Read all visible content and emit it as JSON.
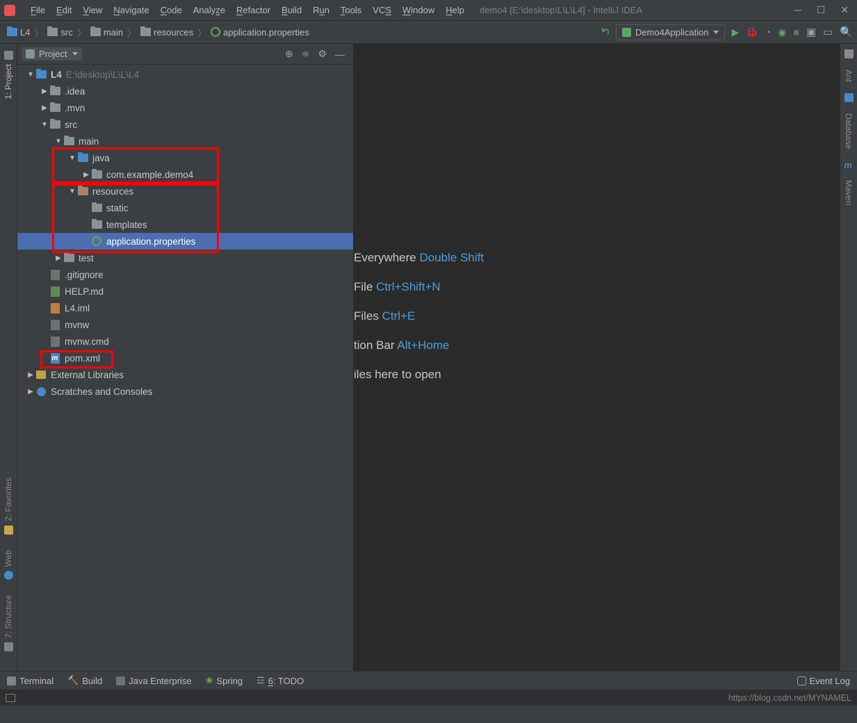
{
  "titlebar": {
    "menus": [
      "File",
      "Edit",
      "View",
      "Navigate",
      "Code",
      "Analyze",
      "Refactor",
      "Build",
      "Run",
      "Tools",
      "VCS",
      "Window",
      "Help"
    ],
    "title": "demo4 [E:\\desktop\\L\\L\\L4] - IntelliJ IDEA"
  },
  "breadcrumb": {
    "items": [
      "L4",
      "src",
      "main",
      "resources",
      "application.properties"
    ]
  },
  "run_config": {
    "label": "Demo4Application"
  },
  "panel": {
    "title": "Project"
  },
  "tree": {
    "root": {
      "name": "L4",
      "path": "E:\\desktop\\L\\L\\L4"
    },
    "idea": ".idea",
    "mvn": ".mvn",
    "src": "src",
    "main": "main",
    "java": "java",
    "pkg": "com.example.demo4",
    "resources": "resources",
    "static": "static",
    "templates": "templates",
    "appprops": "application.properties",
    "test": "test",
    "gitignore": ".gitignore",
    "help": "HELP.md",
    "iml": "L4.iml",
    "mvnw": "mvnw",
    "mvnwcmd": "mvnw.cmd",
    "pom": "pom.xml",
    "ext": "External Libraries",
    "scratch": "Scratches and Consoles"
  },
  "editor_hints": {
    "r1a": "Everywhere  ",
    "r1b": "Double Shift",
    "r2a": "File  ",
    "r2b": "Ctrl+Shift+N",
    "r3a": " Files  ",
    "r3b": "Ctrl+E",
    "r4a": "tion Bar  ",
    "r4b": "Alt+Home",
    "r5": "iles here to open"
  },
  "left_tabs": {
    "project": "1: Project",
    "favorites": "2: Favorites",
    "web": "Web",
    "structure": "7: Structure"
  },
  "right_tabs": {
    "ant": "Ant",
    "database": "Database",
    "maven": "Maven"
  },
  "bottom": {
    "terminal": "Terminal",
    "build": "Build",
    "je": "Java Enterprise",
    "spring": "Spring",
    "todo": "6: TODO",
    "event": "Event Log"
  },
  "status": {
    "url": "https://blog.csdn.net/MYNAMEL"
  }
}
